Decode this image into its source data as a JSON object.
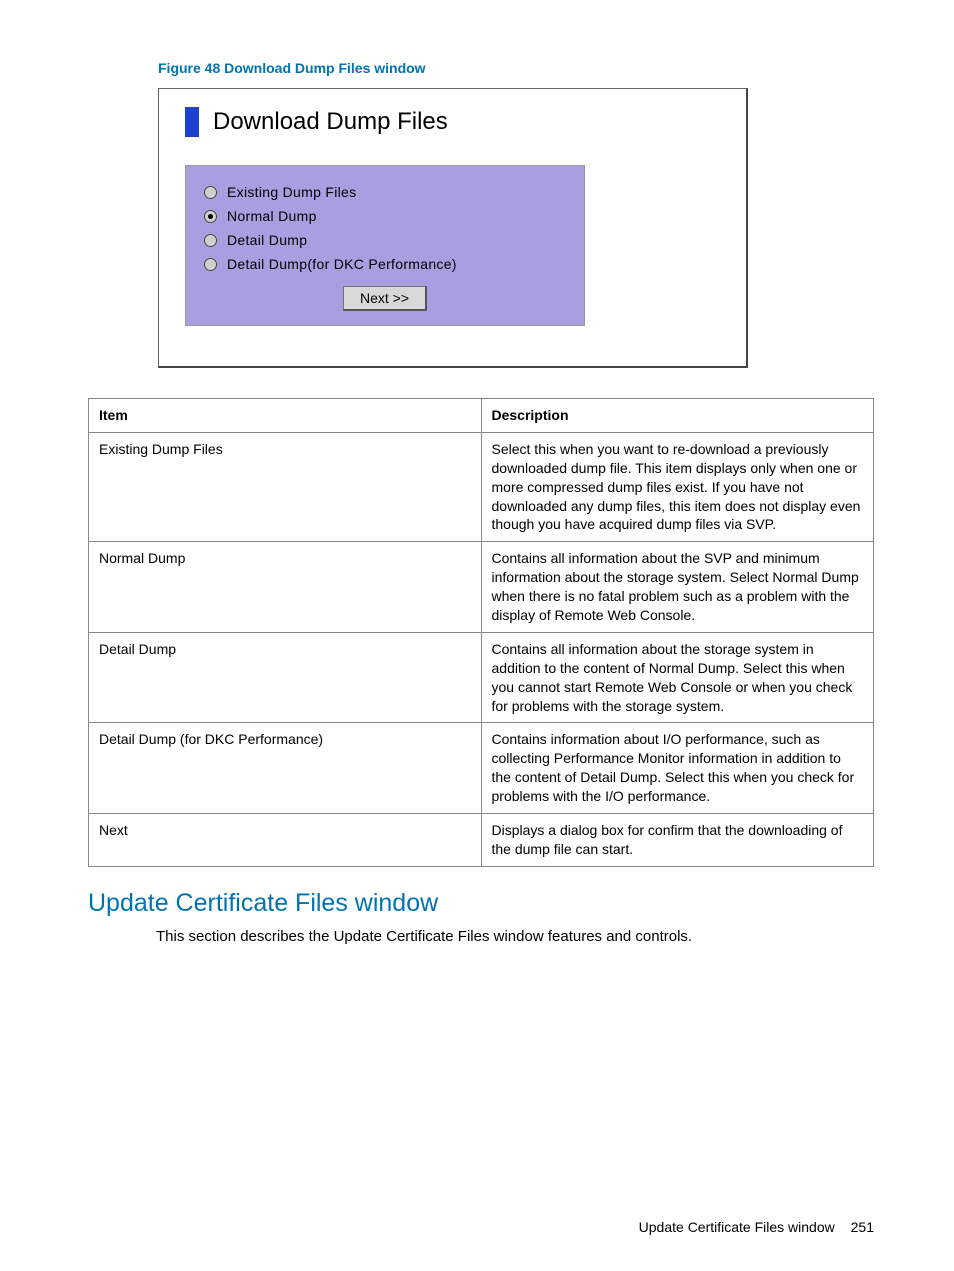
{
  "figureCaption": "Figure 48 Download Dump Files window",
  "dialog": {
    "title": "Download Dump Files",
    "options": {
      "existing": "Existing Dump Files",
      "normal": "Normal Dump",
      "detail": "Detail Dump",
      "detailPerf": "Detail Dump(for DKC Performance)"
    },
    "nextLabel": "Next >>"
  },
  "table": {
    "headers": {
      "item": "Item",
      "description": "Description"
    },
    "rows": [
      {
        "item": "Existing Dump Files",
        "desc": "Select this when you want to re-download a previously downloaded dump file. This item displays only when one or more compressed dump files exist. If you have not downloaded any dump files, this item does not display even though you have acquired dump files via SVP."
      },
      {
        "item": "Normal Dump",
        "desc": "Contains all information about the SVP and minimum information about the storage system. Select Normal Dump when there is no fatal problem such as a problem with the display of Remote Web Console."
      },
      {
        "item": "Detail Dump",
        "desc": "Contains all information about the storage system in addition to the content of Normal Dump. Select this when you cannot start Remote Web Console or when you check for problems with the storage system."
      },
      {
        "item": "Detail Dump (for DKC Performance)",
        "desc": "Contains information about I/O performance, such as collecting Performance Monitor information in addition to the content of Detail Dump. Select this when you check for problems with the I/O performance."
      },
      {
        "item": "Next",
        "desc": "Displays a dialog box for confirm that the downloading of the dump file can start."
      }
    ]
  },
  "sectionHeading": "Update Certificate Files window",
  "sectionBody": "This section describes the Update Certificate Files window features and controls.",
  "footer": {
    "label": "Update Certificate Files window",
    "page": "251"
  }
}
